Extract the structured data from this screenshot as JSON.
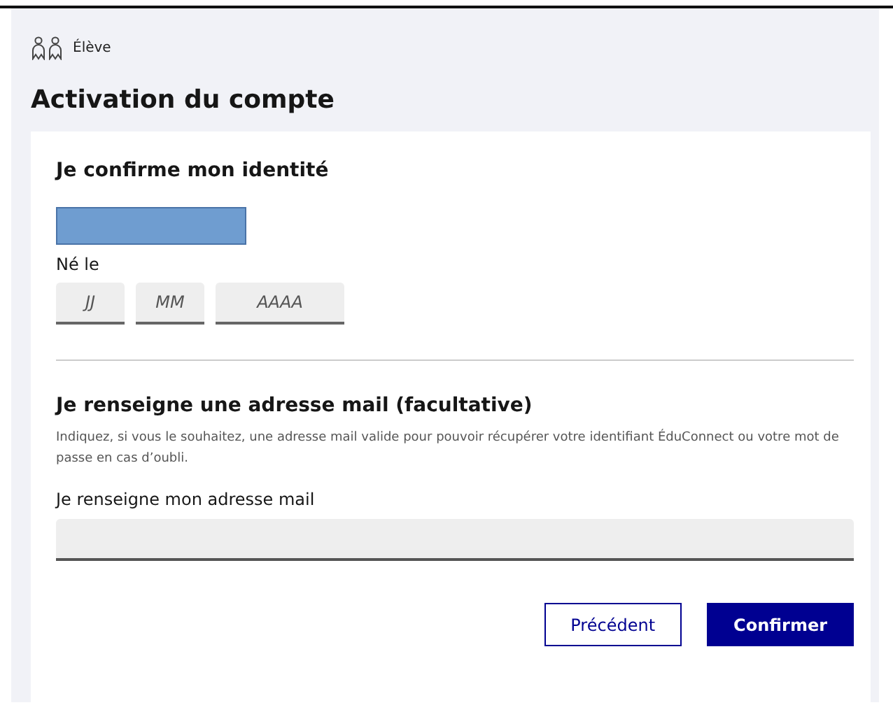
{
  "header": {
    "role": "Élève",
    "title": "Activation du compte"
  },
  "identity": {
    "heading": "Je confirme mon identité",
    "name_redacted": true,
    "birth_label": "Né le",
    "date_fields": [
      {
        "placeholder": "JJ",
        "kind": "short"
      },
      {
        "placeholder": "MM",
        "kind": "short"
      },
      {
        "placeholder": "AAAA",
        "kind": "long"
      }
    ]
  },
  "email": {
    "heading": "Je renseigne une adresse mail (facultative)",
    "hint": "Indiquez, si vous le souhaitez, une adresse mail valide pour pouvoir récupérer votre identifiant ÉduConnect ou votre mot de passe en cas d’oubli.",
    "label": "Je renseigne mon adresse mail"
  },
  "buttons": [
    {
      "label": "Précédent",
      "kind": "secondary"
    },
    {
      "label": "Confirmer",
      "kind": "primary"
    }
  ]
}
